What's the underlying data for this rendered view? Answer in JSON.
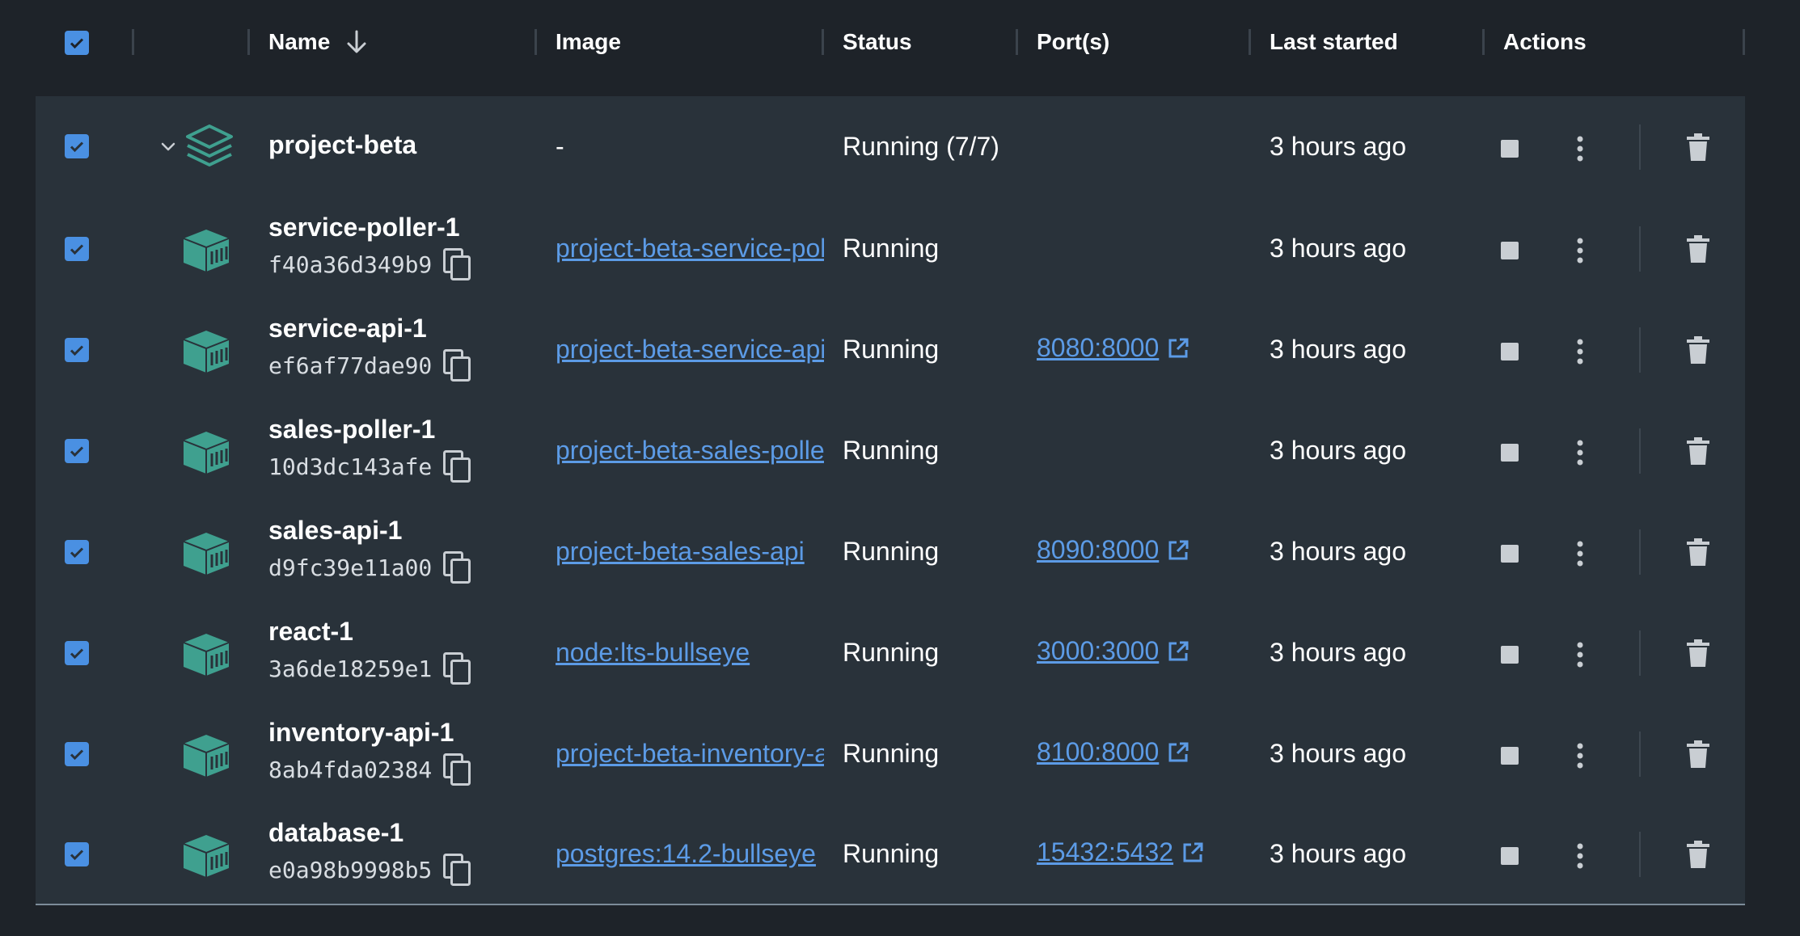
{
  "header": {
    "name": "Name",
    "image": "Image",
    "status": "Status",
    "ports": "Port(s)",
    "last_started": "Last started",
    "actions": "Actions"
  },
  "group": {
    "name": "project-beta",
    "image": "-",
    "status": "Running (7/7)",
    "last_started": "3 hours ago"
  },
  "containers": [
    {
      "name": "service-poller-1",
      "id": "f40a36d349b9",
      "image": "project-beta-service-poller",
      "status": "Running",
      "port": "",
      "last_started": "3 hours ago"
    },
    {
      "name": "service-api-1",
      "id": "ef6af77dae90",
      "image": "project-beta-service-api",
      "status": "Running",
      "port": "8080:8000",
      "last_started": "3 hours ago"
    },
    {
      "name": "sales-poller-1",
      "id": "10d3dc143afe",
      "image": "project-beta-sales-poller",
      "status": "Running",
      "port": "",
      "last_started": "3 hours ago"
    },
    {
      "name": "sales-api-1",
      "id": "d9fc39e11a00",
      "image": "project-beta-sales-api",
      "status": "Running",
      "port": "8090:8000",
      "last_started": "3 hours ago"
    },
    {
      "name": "react-1",
      "id": "3a6de18259e1",
      "image": "node:lts-bullseye",
      "status": "Running",
      "port": "3000:3000",
      "last_started": "3 hours ago"
    },
    {
      "name": "inventory-api-1",
      "id": "8ab4fda02384",
      "image": "project-beta-inventory-api",
      "status": "Running",
      "port": "8100:8000",
      "last_started": "3 hours ago"
    },
    {
      "name": "database-1",
      "id": "e0a98b9998b5",
      "image": "postgres:14.2-bullseye",
      "status": "Running",
      "port": "15432:5432",
      "last_started": "3 hours ago"
    }
  ],
  "colors": {
    "accent": "#4a90e2",
    "link": "#5c9be6",
    "container_icon": "#3fa08f"
  },
  "icons": [
    "checkbox-checked-icon",
    "sort-down-arrow-icon",
    "chevron-down-icon",
    "stack-icon",
    "container-icon",
    "copy-icon",
    "external-link-icon",
    "stop-icon",
    "more-vertical-icon",
    "trash-icon"
  ]
}
